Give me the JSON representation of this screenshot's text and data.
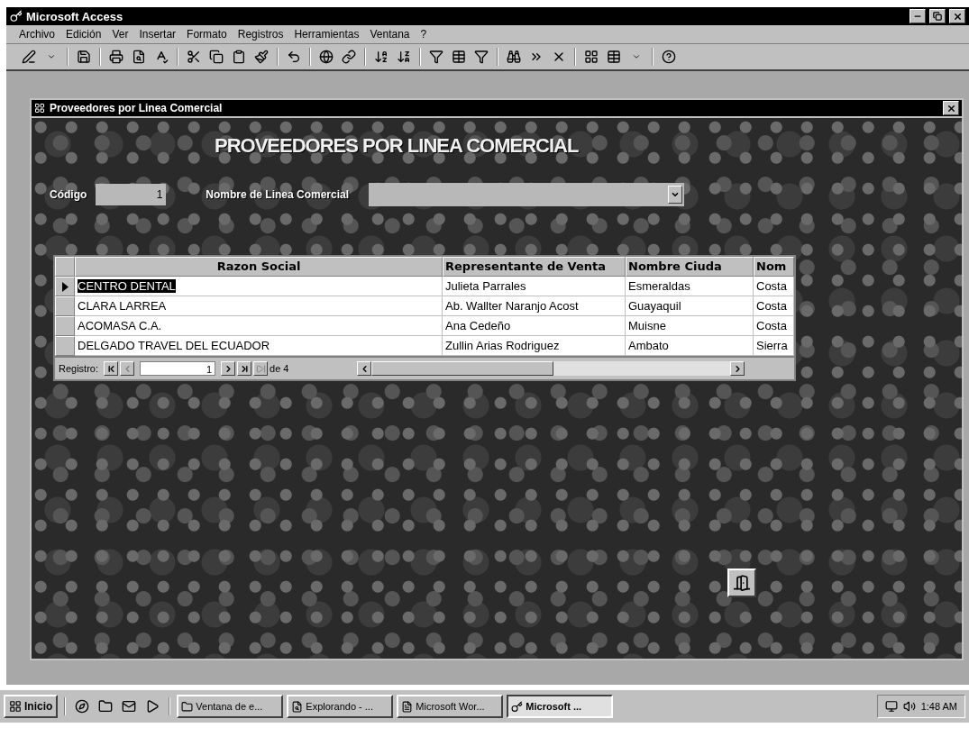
{
  "window": {
    "title": "Microsoft Access"
  },
  "menu": [
    "Archivo",
    "Edición",
    "Ver",
    "Insertar",
    "Formato",
    "Registros",
    "Herramientas",
    "Ventana",
    "?"
  ],
  "form": {
    "title": "Proveedores por Linea Comercial",
    "heading": "PROVEEDORES POR LINEA COMERCIAL",
    "fields": [
      {
        "kind": "text",
        "label": "Código",
        "value": "1"
      },
      {
        "kind": "combo",
        "label": "Nombre de Linea Comercial"
      }
    ],
    "datasheet": {
      "columns": [
        "Razon Social",
        "Representante de Venta",
        "Nombre Ciuda",
        "Nom"
      ],
      "rows": [
        {
          "selected": true,
          "cells": [
            "CENTRO DENTAL",
            "Julieta Parrales",
            "Esmeraldas",
            "Costa"
          ]
        },
        {
          "selected": false,
          "cells": [
            "CLARA LARREA",
            "Ab. Wallter Naranjo Acost",
            "Guayaquil",
            "Costa"
          ]
        },
        {
          "selected": false,
          "cells": [
            "ACOMASA C.A.",
            "Ana Cedeño",
            "Muisne",
            "Costa"
          ]
        },
        {
          "selected": false,
          "cells": [
            "DELGADO TRAVEL DEL ECUADOR",
            "Zullin Arias Rodriguez",
            "Ambato",
            "Sierra"
          ]
        }
      ],
      "navigator": {
        "label": "Registro:",
        "value": "1",
        "total": "de 4"
      }
    }
  },
  "taskbar": {
    "start": "Inicio",
    "tasks": [
      {
        "label": "Ventana de e...",
        "selected": false
      },
      {
        "label": "Explorando - ...",
        "selected": false
      },
      {
        "label": "Microsoft Wor...",
        "selected": false
      },
      {
        "label": "Microsoft ...",
        "selected": true
      }
    ],
    "clock": "1:48 AM"
  }
}
